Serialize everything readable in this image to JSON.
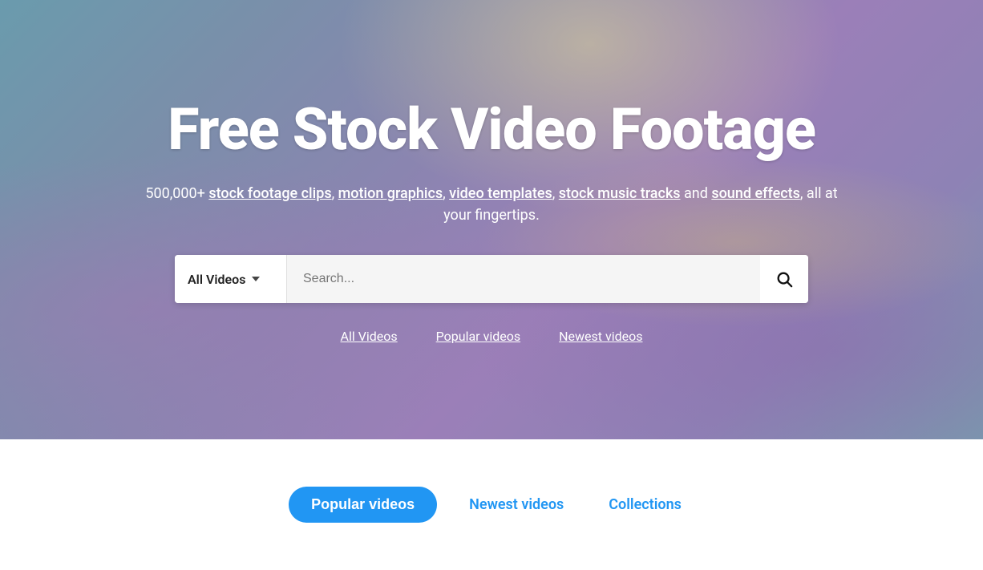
{
  "hero": {
    "title": "Free Stock Video Footage",
    "subtitle_prefix": "500,000+ ",
    "subtitle_suffix": ", all at your fingertips.",
    "subtitle_and": " and ",
    "links": [
      {
        "label": "stock footage clips",
        "id": "stock-footage-link"
      },
      {
        "label": "motion graphics",
        "id": "motion-graphics-link"
      },
      {
        "label": "video templates",
        "id": "video-templates-link"
      },
      {
        "label": "stock music tracks",
        "id": "stock-music-link"
      },
      {
        "label": "sound effects",
        "id": "sound-effects-link"
      }
    ],
    "search": {
      "category": "All Videos",
      "placeholder": "Search...",
      "button_icon": "🔍"
    },
    "quick_links": [
      {
        "label": "All Videos"
      },
      {
        "label": "Popular videos"
      },
      {
        "label": "Newest videos"
      }
    ]
  },
  "bottom_tabs": [
    {
      "label": "Popular videos",
      "active": true
    },
    {
      "label": "Newest videos",
      "active": false
    },
    {
      "label": "Collections",
      "active": false
    }
  ]
}
